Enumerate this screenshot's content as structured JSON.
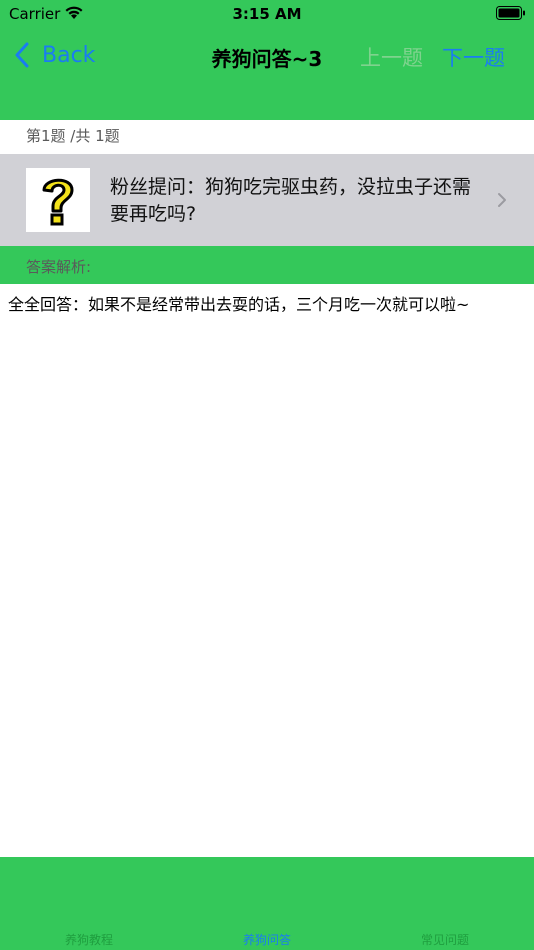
{
  "status_bar": {
    "carrier": "Carrier",
    "time": "3:15 AM"
  },
  "nav": {
    "back_label": "Back",
    "title": "养狗问答~3",
    "prev_label": "上一题",
    "next_label": "下一题"
  },
  "counter": "第1题 /共 1题",
  "question": {
    "text": "粉丝提问：狗狗吃完驱虫药，没拉虫子还需要再吃吗?",
    "icon": "question-mark-icon"
  },
  "answer": {
    "label": "答案解析:",
    "text": "全全回答：如果不是经常带出去耍的话，三个月吃一次就可以啦~"
  },
  "tabs": [
    {
      "label": "养狗教程"
    },
    {
      "label": "养狗问答"
    },
    {
      "label": "常见问题"
    }
  ],
  "colors": {
    "bar_green": "#34c85a",
    "link_blue": "#1a7cf2",
    "row_gray": "#d1d1d6",
    "disabled_green": "#7fd38e"
  }
}
